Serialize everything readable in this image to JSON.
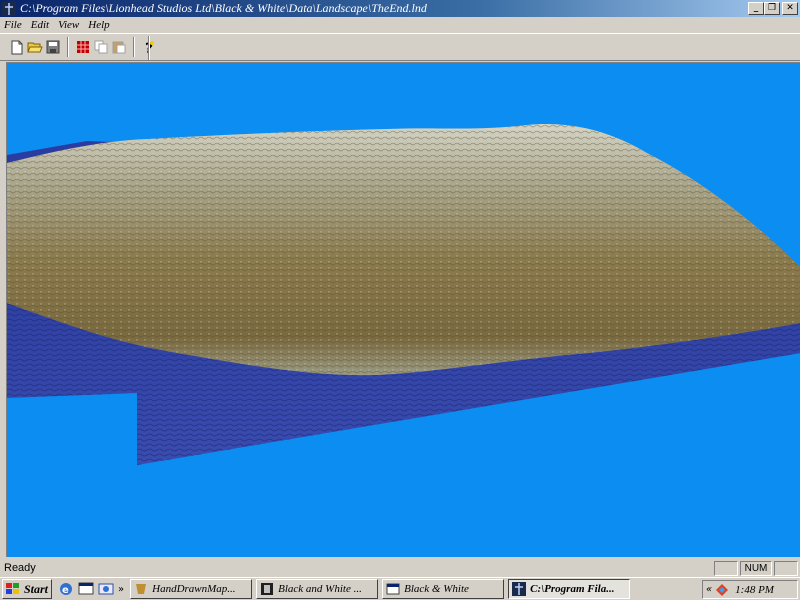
{
  "window": {
    "title": "C:\\Program Files\\Lionhead Studios Ltd\\Black & White\\Data\\Landscape\\TheEnd.lnd",
    "minimize_glyph": "_",
    "restore_glyph": "❐",
    "close_glyph": "✕"
  },
  "menu": {
    "items": [
      {
        "label": "File"
      },
      {
        "label": "Edit"
      },
      {
        "label": "View"
      },
      {
        "label": "Help"
      }
    ]
  },
  "toolbar": {
    "buttons": [
      "new-file-icon",
      "open-folder-icon",
      "save-icon",
      "grid-icon",
      "copy-icon",
      "paste-icon",
      "help-icon"
    ]
  },
  "viewport": {
    "sky_color": "#0b8df2",
    "water_color": "#2a3ca0",
    "land_color": "#8a7a4a",
    "peak_color": "#c8c8b8"
  },
  "status": {
    "text": "Ready",
    "num_indicator": "NUM"
  },
  "taskbar": {
    "start_label": "Start",
    "quick_launch_more": "»",
    "tasks": [
      {
        "label": "HandDrawnMap...",
        "active": false
      },
      {
        "label": "Black and White ...",
        "active": false
      },
      {
        "label": "Black & White",
        "active": false
      },
      {
        "label": "C:\\Program Fila...",
        "active": true
      }
    ],
    "tray_more": "«",
    "clock": "1:48 PM"
  }
}
